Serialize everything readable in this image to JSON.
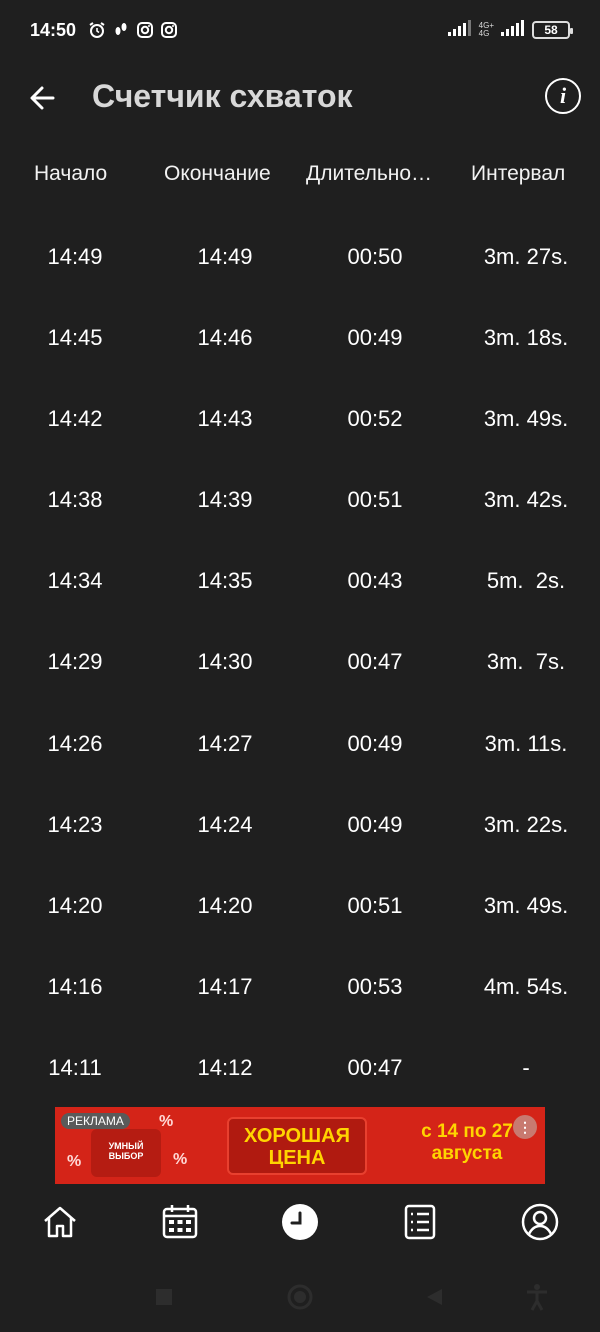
{
  "status_bar": {
    "time": "14:50",
    "network_top": "4G+",
    "network_bottom": "4G",
    "battery": "58"
  },
  "app_bar": {
    "title": "Счетчик схваток"
  },
  "table": {
    "headers": [
      "Начало",
      "Окончание",
      "Длительно…",
      "Интервал"
    ],
    "rows": [
      [
        "14:49",
        "14:49",
        "00:50",
        "3m. 27s."
      ],
      [
        "14:45",
        "14:46",
        "00:49",
        "3m. 18s."
      ],
      [
        "14:42",
        "14:43",
        "00:52",
        "3m. 49s."
      ],
      [
        "14:38",
        "14:39",
        "00:51",
        "3m. 42s."
      ],
      [
        "14:34",
        "14:35",
        "00:43",
        "5m.  2s."
      ],
      [
        "14:29",
        "14:30",
        "00:47",
        "3m.  7s."
      ],
      [
        "14:26",
        "14:27",
        "00:49",
        "3m. 11s."
      ],
      [
        "14:23",
        "14:24",
        "00:49",
        "3m. 22s."
      ],
      [
        "14:20",
        "14:20",
        "00:51",
        "3m. 49s."
      ],
      [
        "14:16",
        "14:17",
        "00:53",
        "4m. 54s."
      ],
      [
        "14:11",
        "14:12",
        "00:47",
        "-"
      ]
    ]
  },
  "ad": {
    "label": "РЕКЛАМА",
    "badge": "УМНЫЙ ВЫБОР",
    "cta_line1": "ХОРОШАЯ",
    "cta_line2": "ЦЕНА",
    "dates_line1": "с 14 по 27",
    "dates_line2": "августа",
    "colors": {
      "background": "#d42418",
      "accent": "#ffd400"
    }
  },
  "bottom_nav": {
    "items": [
      "home-icon",
      "calendar-icon",
      "clock-icon",
      "list-icon",
      "profile-icon"
    ],
    "active": "clock-icon"
  }
}
